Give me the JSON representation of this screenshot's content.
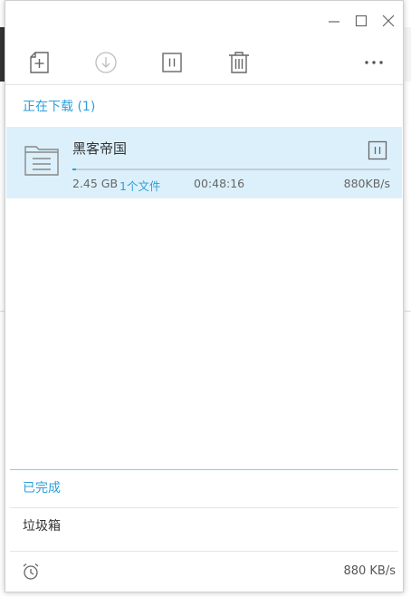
{
  "toolbar": {
    "new_task_icon": "add-file-icon",
    "download_icon": "download-icon",
    "pause_icon": "pause-icon",
    "delete_icon": "trash-icon",
    "more_icon": "more-icon"
  },
  "downloading": {
    "header": "正在下载 (1)",
    "tasks": [
      {
        "name": "黑客帝国",
        "size": "2.45 GB",
        "files": "1个文件",
        "remaining": "00:48:16",
        "speed": "880KB/s",
        "progress": 0.01
      }
    ]
  },
  "completed": {
    "label": "已完成"
  },
  "trash": {
    "label": "垃圾箱"
  },
  "footer": {
    "speed": "880 KB/s"
  },
  "colors": {
    "accent": "#2d9fd9",
    "task_bg": "#dcf0fb",
    "icon": "#666666"
  }
}
